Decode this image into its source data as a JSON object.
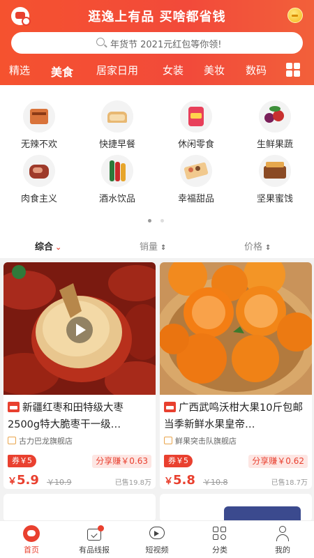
{
  "header": {
    "slogan": "逛逸上有品 买啥都省钱",
    "search_placeholder": "年货节 2021元红包等你领!"
  },
  "categories": [
    "精选",
    "美食",
    "居家日用",
    "女装",
    "美妆",
    "数码"
  ],
  "quick_categories": [
    "无辣不欢",
    "快捷早餐",
    "休闲零食",
    "生鲜果蔬",
    "肉食主义",
    "酒水饮品",
    "幸福甜品",
    "坚果蜜饯"
  ],
  "sort": {
    "comprehensive": "综合",
    "sales": "销量",
    "price": "价格"
  },
  "products": [
    {
      "title": "新疆红枣和田特级大枣2500g特大脆枣干一级…",
      "shop": "古力巴龙旗舰店",
      "coupon": "券￥5",
      "share": "分享赚￥0.63",
      "yen": "￥",
      "price": "5.9",
      "original_price": "￥10.9",
      "sold": "已售19.8万"
    },
    {
      "title": "广西武鸣沃柑大果10斤包邮当季新鲜水果皇帝…",
      "shop": "鲜果突击队旗舰店",
      "coupon": "券￥5",
      "share": "分享赚￥0.62",
      "yen": "￥",
      "price": "5.8",
      "original_price": "￥10.8",
      "sold": "已售18.7万"
    }
  ],
  "tabbar": [
    "首页",
    "有品线报",
    "短视频",
    "分类",
    "我的"
  ],
  "colors": {
    "brand": "#f24a3a",
    "price": "#e9402f",
    "share_bg": "#fde6e3"
  }
}
